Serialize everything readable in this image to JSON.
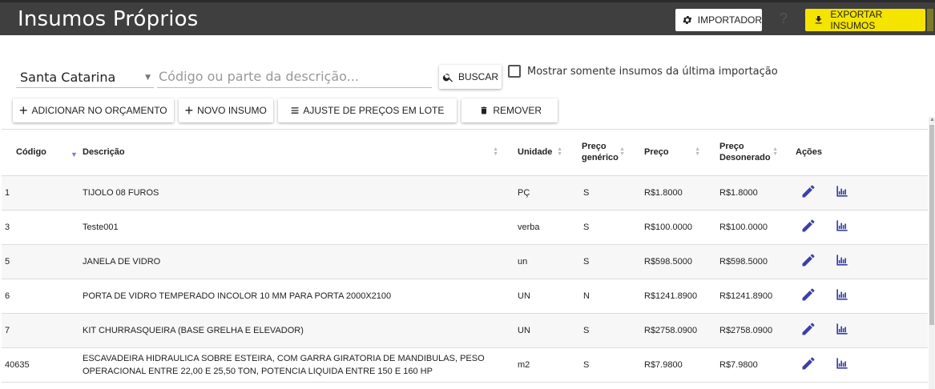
{
  "header": {
    "title": "Insumos Próprios",
    "importer_label": "IMPORTADOR",
    "help_label": "?",
    "export_label": "EXPORTAR INSUMOS"
  },
  "filters": {
    "state": "Santa Catarina",
    "search_placeholder": "Código ou parte da descrição...",
    "search_button": "BUSCAR",
    "checkbox_label": "Mostrar somente insumos da última importação"
  },
  "toolbar": {
    "add_budget": "ADICIONAR NO ORÇAMENTO",
    "new_item": "NOVO INSUMO",
    "price_adjust": "AJUSTE DE PREÇOS EM LOTE",
    "remove": "REMOVER"
  },
  "table": {
    "headers": {
      "code": "Código",
      "description": "Descrição",
      "unit": "Unidade",
      "generic_price_1": "Preço",
      "generic_price_2": "genérico",
      "price": "Preço",
      "desonerado_1": "Preço",
      "desonerado_2": "Desonerado",
      "actions": "Ações"
    },
    "rows": [
      {
        "code": "1",
        "description": "TIJOLO 08 FUROS",
        "unit": "PÇ",
        "generic": "S",
        "price": "R$1.8000",
        "desonerado": "R$1.8000"
      },
      {
        "code": "3",
        "description": "Teste001",
        "unit": "verba",
        "generic": "S",
        "price": "R$100.0000",
        "desonerado": "R$100.0000"
      },
      {
        "code": "5",
        "description": "JANELA DE VIDRO",
        "unit": "un",
        "generic": "S",
        "price": "R$598.5000",
        "desonerado": "R$598.5000"
      },
      {
        "code": "6",
        "description": "PORTA DE VIDRO TEMPERADO INCOLOR 10 MM PARA PORTA 2000X2100",
        "unit": "UN",
        "generic": "N",
        "price": "R$1241.8900",
        "desonerado": "R$1241.8900"
      },
      {
        "code": "7",
        "description": "KIT CHURRASQUEIRA (BASE GRELHA E ELEVADOR)",
        "unit": "UN",
        "generic": "S",
        "price": "R$2758.0900",
        "desonerado": "R$2758.0900"
      },
      {
        "code": "40635",
        "description": "ESCAVADEIRA HIDRAULICA SOBRE ESTEIRA, COM GARRA GIRATORIA DE MANDIBULAS, PESO OPERACIONAL ENTRE 22,00 E 25,50 TON, POTENCIA LIQUIDA ENTRE 150 E 160 HP",
        "unit": "m2",
        "generic": "S",
        "price": "R$7.9800",
        "desonerado": "R$7.9800"
      }
    ]
  },
  "colors": {
    "header_bg": "#3f3f3f",
    "export_bg": "#f5e400",
    "action_icon": "#3a3fa8"
  },
  "icons": {
    "importer": "gear-icon",
    "export": "download-icon",
    "search": "search-icon",
    "add": "plus-icon",
    "adjust": "menu-lines-icon",
    "remove": "trash-icon",
    "edit": "pencil-icon",
    "history": "bar-chart-icon"
  }
}
